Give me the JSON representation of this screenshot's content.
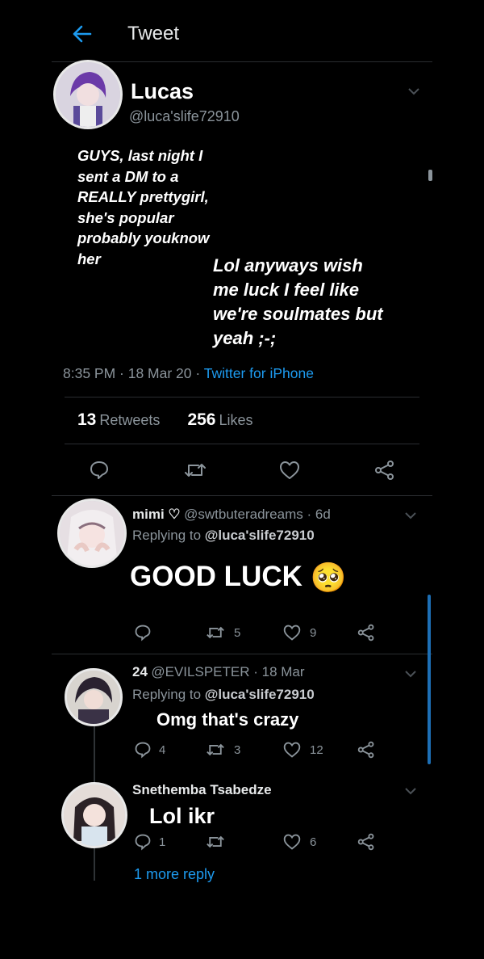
{
  "header": {
    "title": "Tweet"
  },
  "main_tweet": {
    "name": "Lucas",
    "handle": "@luca'slife72910",
    "text_left": "GUYS, last night I sent a DM to a REALLY prettygirl, she's popular probably youknow her",
    "text_right": "Lol anyways wish me luck I feel like we're soulmates but yeah ;-;",
    "time": "8:35 PM · 18 Mar 20 · ",
    "source": "Twitter for iPhone",
    "retweets_count": "13",
    "retweets_label": "Retweets",
    "likes_count": "256",
    "likes_label": "Likes"
  },
  "replies": [
    {
      "name": "mimi ♡",
      "handle": "@swtbuteradreams · 6d",
      "replying_prefix": "Replying to ",
      "replying_to": "@luca'slife72910",
      "text": "GOOD LUCK",
      "emoji": "🥺",
      "retweets": "5",
      "likes": "9"
    },
    {
      "name": "24",
      "handle": "@EVILSPETER · 18 Mar",
      "replying_prefix": "Replying to ",
      "replying_to": "@luca'slife72910",
      "text": "Omg that's crazy",
      "comments": "4",
      "retweets": "3",
      "likes": "12"
    },
    {
      "name": "Snethemba Tsabedze",
      "text": "Lol ikr",
      "comments": "1",
      "likes": "6"
    }
  ],
  "more_reply": "1 more reply",
  "colors": {
    "accent": "#1d9bf0",
    "background": "#000000",
    "muted": "#8b949b"
  }
}
